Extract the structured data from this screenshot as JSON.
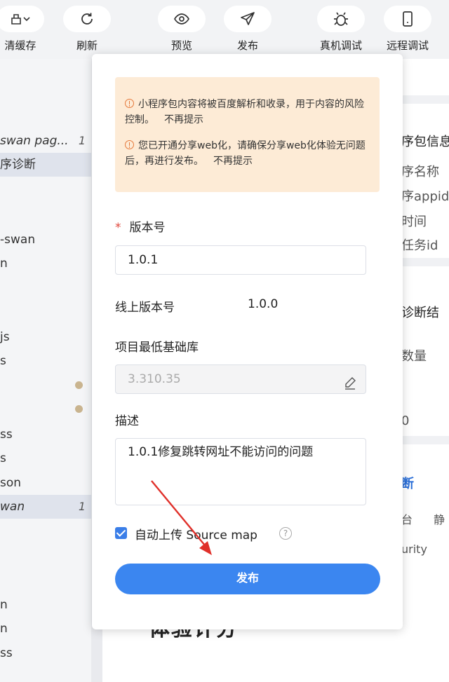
{
  "toolbar": {
    "items": [
      {
        "label": "清缓存",
        "icon": "clean-cache-icon"
      },
      {
        "label": "刷新",
        "icon": "refresh-icon"
      },
      {
        "label": "预览",
        "icon": "eye-icon"
      },
      {
        "label": "发布",
        "icon": "send-icon"
      },
      {
        "label": "真机调试",
        "icon": "bug-icon"
      },
      {
        "label": "远程调试",
        "icon": "phone-icon"
      }
    ]
  },
  "file_tree": {
    "items": [
      {
        "label": "swan  pag...",
        "count": "1"
      },
      {
        "label": "序诊断",
        "count": ""
      },
      {
        "label": "-swan",
        "count": ""
      },
      {
        "label": "n",
        "count": ""
      },
      {
        "label": "js",
        "count": ""
      },
      {
        "label": "s",
        "count": ""
      },
      {
        "label": "ss",
        "count": ""
      },
      {
        "label": "s",
        "count": ""
      },
      {
        "label": "son",
        "count": ""
      },
      {
        "label": "wan",
        "count": "1"
      },
      {
        "label": "n",
        "count": ""
      },
      {
        "label": "n",
        "count": ""
      },
      {
        "label": "ss",
        "count": ""
      }
    ]
  },
  "right_panel": {
    "lines": [
      "序包信息",
      "序名称",
      "序appid",
      "时间",
      "任务id",
      "诊断结",
      "数量",
      "0"
    ],
    "tab": "断",
    "tabs_row": [
      "台",
      "静"
    ],
    "security": "urity",
    "big_text": "体验计分"
  },
  "modal": {
    "notices": [
      {
        "text": "小程序包内容将被百度解析和收录，用于内容的风险控制。",
        "action": "不再提示"
      },
      {
        "text": "您已开通分享web化，请确保分享web化体验无问题后，再进行发布。",
        "action": "不再提示"
      }
    ],
    "version_label": "版本号",
    "version_required_mark": "*",
    "version_value": "1.0.1",
    "online_version_label": "线上版本号",
    "online_version_value": "1.0.0",
    "min_lib_label": "项目最低基础库",
    "min_lib_value": "3.310.35",
    "description_label": "描述",
    "description_value": "1.0.1修复跳转网址不能访问的问题",
    "sourcemap_label": "自动上传 Source map",
    "sourcemap_checked": true,
    "help_glyph": "?",
    "publish_button": "发布"
  },
  "colors": {
    "primary": "#3b86f0",
    "notice_bg": "#fdebd6",
    "warning": "#e5793b",
    "annotation_arrow": "#e0302a"
  }
}
